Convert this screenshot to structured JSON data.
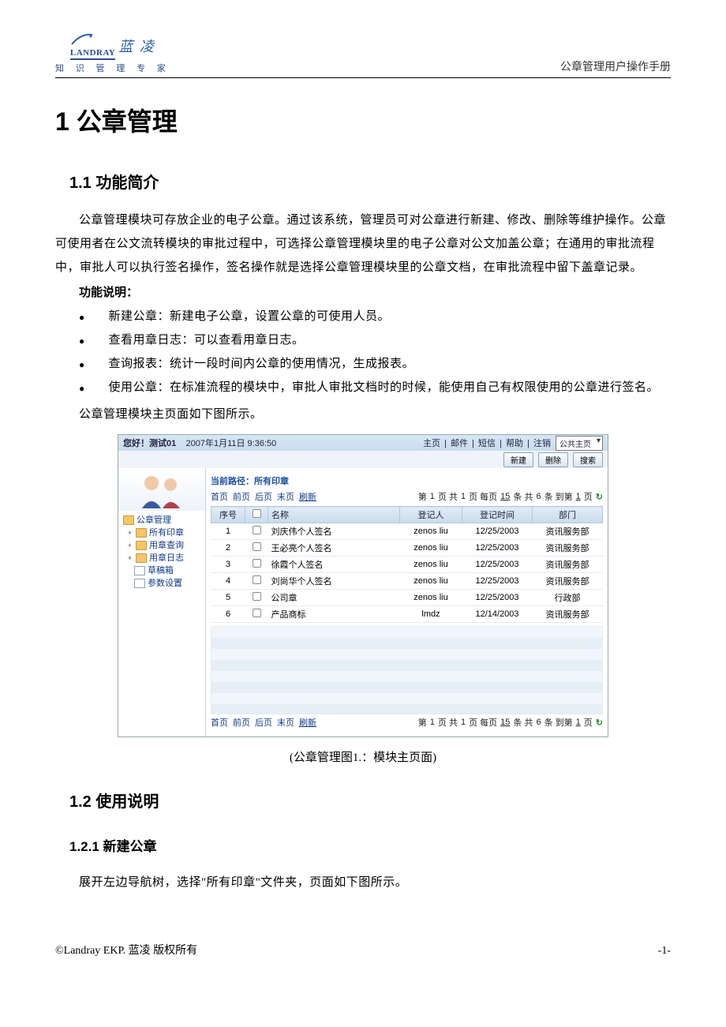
{
  "header": {
    "logo_word": "LANDRAY",
    "logo_cn": "蓝 凌",
    "logo_sub": "知 识 管 理 专 家",
    "doc_title": "公章管理用户操作手册"
  },
  "h1": "1 公章管理",
  "h2_1": "1.1  功能简介",
  "intro": "公章管理模块可存放企业的电子公章。通过该系统，管理员可对公章进行新建、修改、删除等维护操作。公章可使用者在公文流转模块的审批过程中，可选择公章管理模块里的电子公章对公文加盖公章；在通用的审批流程中，审批人可以执行签名操作，签名操作就是选择公章管理模块里的公章文档，在审批流程中留下盖章记录。",
  "features_label": "功能说明：",
  "features": [
    "新建公章：新建电子公章，设置公章的可使用人员。",
    "查看用章日志：可以查看用章日志。",
    "查询报表：统计一段时间内公章的使用情况，生成报表。",
    "使用公章：在标准流程的模块中，审批人审批文档时的时候，能使用自己有权限使用的公章进行签名。"
  ],
  "module_line": "公章管理模块主页面如下图所示。",
  "caption": "(公章管理图1.：模块主页面)",
  "h2_2": "1.2  使用说明",
  "h3_1": "1.2.1  新建公章",
  "p_new": "展开左边导航树，选择\"所有印章\"文件夹，页面如下图所示。",
  "footer": {
    "left": "©Landray EKP.  蓝凌  版权所有",
    "right": "-1-"
  },
  "shot": {
    "greeting": "您好！测试01",
    "datetime": "2007年1月11日 9:36:50",
    "top_menu": [
      "主页",
      "邮件",
      "短信",
      "帮助",
      "注销"
    ],
    "dropdown": "公共主页",
    "toolbar": [
      "新建",
      "删除",
      "搜索"
    ],
    "tree": {
      "root": "公章管理",
      "items": [
        {
          "exp": "+",
          "icon": "folder",
          "label": "所有印章"
        },
        {
          "exp": "+",
          "icon": "folder",
          "label": "用章查询"
        },
        {
          "exp": "+",
          "icon": "folder",
          "label": "用章日志"
        },
        {
          "exp": "",
          "icon": "page",
          "label": "草稿箱"
        },
        {
          "exp": "",
          "icon": "page",
          "label": "参数设置"
        }
      ]
    },
    "crumb": "当前路径：所有印章",
    "pager": {
      "links": [
        "首页",
        "前页",
        "后页",
        "末页"
      ],
      "refresh": "刷新",
      "seg1_a": "第",
      "seg1_b": "1",
      "seg1_c": "页 共",
      "seg1_d": "1",
      "seg1_e": "页 每页",
      "perpage": "15",
      "seg2": "条 共",
      "total": "6",
      "seg3": "条 到第",
      "goto": "1",
      "seg4": "页"
    },
    "columns": [
      "序号",
      "",
      "名称",
      "登记人",
      "登记时间",
      "部门"
    ],
    "rows": [
      {
        "n": "1",
        "name": "刘庆伟个人签名",
        "reg": "zenos liu",
        "date": "12/25/2003",
        "dept": "资讯服务部"
      },
      {
        "n": "2",
        "name": "王必亮个人签名",
        "reg": "zenos liu",
        "date": "12/25/2003",
        "dept": "资讯服务部"
      },
      {
        "n": "3",
        "name": "徐霞个人签名",
        "reg": "zenos liu",
        "date": "12/25/2003",
        "dept": "资讯服务部"
      },
      {
        "n": "4",
        "name": "刘尚华个人签名",
        "reg": "zenos liu",
        "date": "12/25/2003",
        "dept": "资讯服务部"
      },
      {
        "n": "5",
        "name": "公司章",
        "reg": "zenos liu",
        "date": "12/25/2003",
        "dept": "行政部"
      },
      {
        "n": "6",
        "name": "产品商标",
        "reg": "lmdz",
        "date": "12/14/2003",
        "dept": "资讯服务部"
      }
    ]
  }
}
